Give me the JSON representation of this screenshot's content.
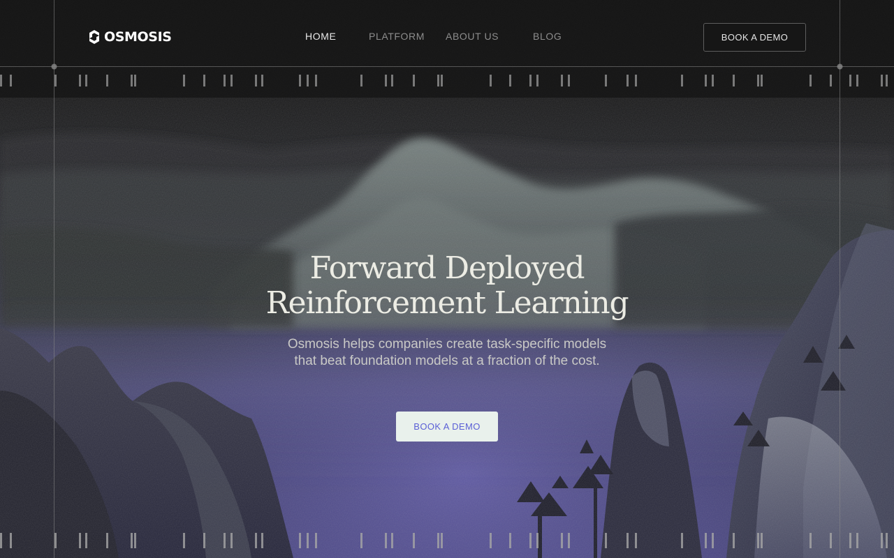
{
  "brand": {
    "name": "OSMOSIS",
    "logo_icon": "osmosis-logo-icon"
  },
  "nav": {
    "items": [
      {
        "label": "HOME",
        "active": true
      },
      {
        "label": "PLATFORM",
        "active": false
      },
      {
        "label": "ABOUT US",
        "active": false
      },
      {
        "label": "BLOG",
        "active": false
      }
    ],
    "cta_label": "BOOK A DEMO"
  },
  "hero": {
    "title_line1": "Forward Deployed",
    "title_line2": "Reinforcement Learning",
    "subtitle_line1": "Osmosis helps companies create task-specific models",
    "subtitle_line2": "that beat foundation models at a fraction of the cost.",
    "cta_label": "BOOK A DEMO"
  },
  "colors": {
    "background": "#131313",
    "hero_button_bg": "#e9f1ec",
    "hero_button_text": "#5a5fd6",
    "nav_active": "#e9e9e9",
    "nav_inactive": "#8d8d8d"
  }
}
